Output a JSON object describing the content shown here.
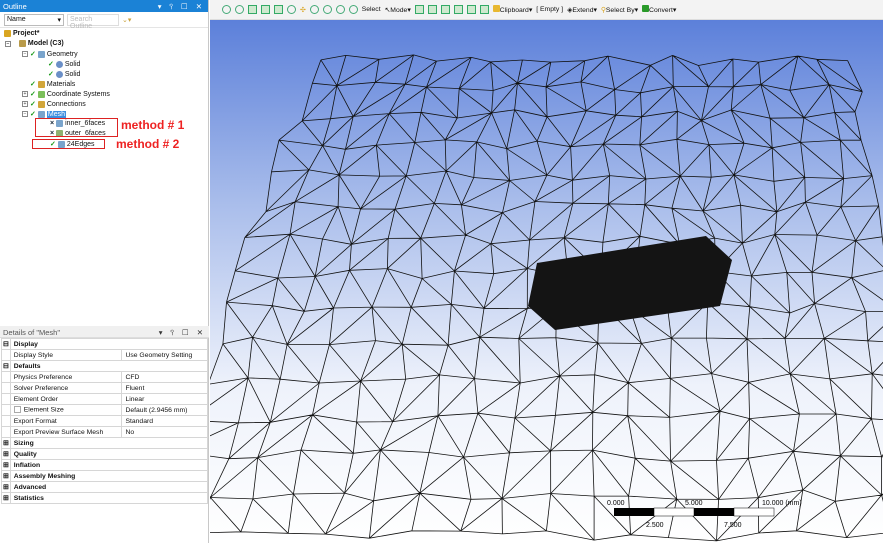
{
  "outline": {
    "title": "Outline",
    "sort_select": "Name",
    "search_placeholder": "Search Outline",
    "tree": {
      "project": "Project*",
      "model": "Model (C3)",
      "geometry": "Geometry",
      "solid1": "Solid",
      "solid2": "Solid",
      "materials": "Materials",
      "coord": "Coordinate Systems",
      "connections": "Connections",
      "mesh": "Mesh",
      "inner": "inner_6faces",
      "outer": "outer_6faces",
      "edges": "24Edges"
    },
    "annotations": {
      "m1": "method # 1",
      "m2": "method # 2"
    }
  },
  "details": {
    "title": "Details of \"Mesh\"",
    "groups": {
      "display": "Display",
      "defaults": "Defaults",
      "sizing": "Sizing",
      "quality": "Quality",
      "inflation": "Inflation",
      "assembly": "Assembly Meshing",
      "advanced": "Advanced",
      "statistics": "Statistics"
    },
    "rows": [
      {
        "k": "Display Style",
        "v": "Use Geometry Setting"
      },
      {
        "k": "Physics Preference",
        "v": "CFD"
      },
      {
        "k": "Solver Preference",
        "v": "Fluent"
      },
      {
        "k": "Element Order",
        "v": "Linear"
      },
      {
        "k": "Element Size",
        "v": "Default (2.9456 mm)"
      },
      {
        "k": "Export Format",
        "v": "Standard"
      },
      {
        "k": "Export Preview Surface Mesh",
        "v": "No"
      }
    ]
  },
  "toolbar": {
    "select": "Select",
    "mode": "Mode",
    "clipboard": "Clipboard",
    "empty": "[ Empty ]",
    "extend": "Extend",
    "select_by": "Select By",
    "convert": "Convert"
  },
  "scale": {
    "t0": "0.000",
    "t1": "5.000",
    "t2": "10.000 (mm)",
    "t3": "2.500",
    "t4": "7.500"
  }
}
